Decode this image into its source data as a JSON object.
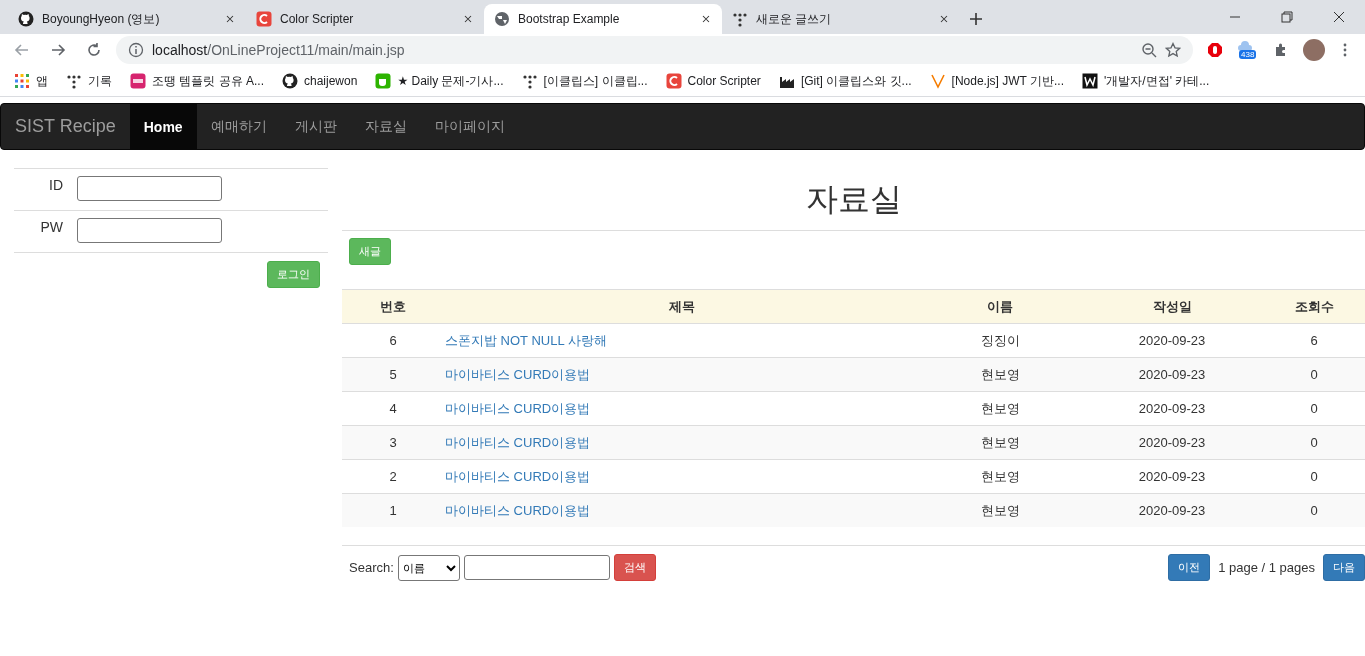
{
  "browser": {
    "tabs": [
      {
        "title": "BoyoungHyeon (영보)",
        "kind": "github",
        "selected": false
      },
      {
        "title": "Color Scripter",
        "kind": "c",
        "selected": false
      },
      {
        "title": "Bootstrap Example",
        "kind": "globe",
        "selected": true
      },
      {
        "title": "새로운 글쓰기",
        "kind": "dots",
        "selected": false
      }
    ],
    "address": {
      "host": "localhost",
      "path": "/OnLineProject11/main/main.jsp"
    },
    "extension_badge": "438",
    "bookmarks": [
      {
        "label": "앱",
        "kind": "apps"
      },
      {
        "label": "기록",
        "kind": "dots"
      },
      {
        "label": "조땡 템플릿 공유 A...",
        "kind": "ppt"
      },
      {
        "label": "chaijewon",
        "kind": "github"
      },
      {
        "label": "★ Daily 문제-기사...",
        "kind": "cup"
      },
      {
        "label": "[이클립스] 이클립...",
        "kind": "dots"
      },
      {
        "label": "Color Scripter",
        "kind": "c"
      },
      {
        "label": "[Git] 이클립스와 깃...",
        "kind": "factory"
      },
      {
        "label": "[Node.js] JWT 기반...",
        "kind": "v"
      },
      {
        "label": "'개발자/면접' 카테...",
        "kind": "w"
      }
    ]
  },
  "navbar": {
    "brand": "SIST Recipe",
    "items": [
      {
        "label": "Home",
        "selected": true
      },
      {
        "label": "예매하기",
        "selected": false
      },
      {
        "label": "게시판",
        "selected": false
      },
      {
        "label": "자료실",
        "selected": false
      },
      {
        "label": "마이페이지",
        "selected": false
      }
    ]
  },
  "login": {
    "id_label": "ID",
    "pw_label": "PW",
    "button": "로그인"
  },
  "board": {
    "title": "자료실",
    "new_button": "새글",
    "columns": [
      "번호",
      "제목",
      "이름",
      "작성일",
      "조회수"
    ],
    "rows": [
      [
        "6",
        "스폰지밥 NOT NULL 사랑해",
        "징징이",
        "2020-09-23",
        "6"
      ],
      [
        "5",
        "마이바티스 CURD이용법",
        "현보영",
        "2020-09-23",
        "0"
      ],
      [
        "4",
        "마이바티스 CURD이용법",
        "현보영",
        "2020-09-23",
        "0"
      ],
      [
        "3",
        "마이바티스 CURD이용법",
        "현보영",
        "2020-09-23",
        "0"
      ],
      [
        "2",
        "마이바티스 CURD이용법",
        "현보영",
        "2020-09-23",
        "0"
      ],
      [
        "1",
        "마이바티스 CURD이용법",
        "현보영",
        "2020-09-23",
        "0"
      ]
    ],
    "search": {
      "label": "Search:",
      "option": "이름",
      "button": "검색"
    },
    "pager": {
      "prev": "이전",
      "info": "1 page / 1 pages",
      "next": "다음"
    }
  }
}
